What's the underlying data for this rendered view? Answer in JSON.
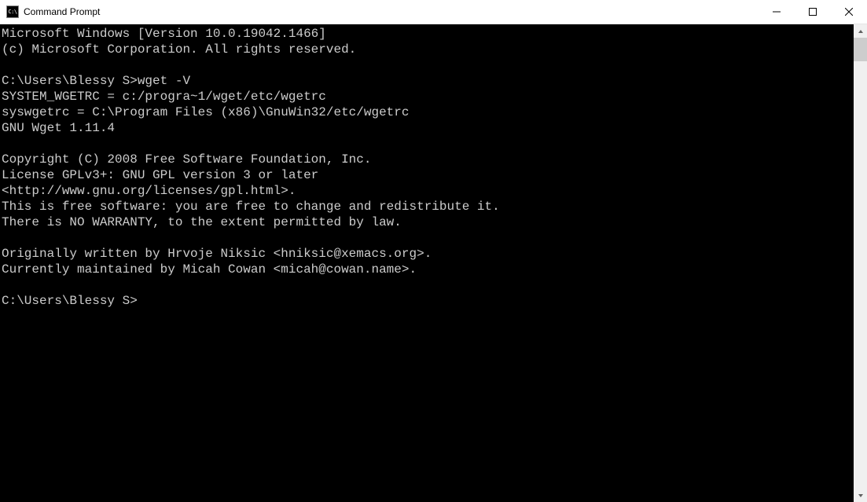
{
  "window": {
    "title": "Command Prompt",
    "icon_label": "C:\\"
  },
  "terminal": {
    "lines": [
      "Microsoft Windows [Version 10.0.19042.1466]",
      "(c) Microsoft Corporation. All rights reserved.",
      "",
      "C:\\Users\\Blessy S>wget -V",
      "SYSTEM_WGETRC = c:/progra~1/wget/etc/wgetrc",
      "syswgetrc = C:\\Program Files (x86)\\GnuWin32/etc/wgetrc",
      "GNU Wget 1.11.4",
      "",
      "Copyright (C) 2008 Free Software Foundation, Inc.",
      "License GPLv3+: GNU GPL version 3 or later",
      "<http://www.gnu.org/licenses/gpl.html>.",
      "This is free software: you are free to change and redistribute it.",
      "There is NO WARRANTY, to the extent permitted by law.",
      "",
      "Originally written by Hrvoje Niksic <hniksic@xemacs.org>.",
      "Currently maintained by Micah Cowan <micah@cowan.name>.",
      ""
    ],
    "current_prompt": "C:\\Users\\Blessy S>"
  }
}
